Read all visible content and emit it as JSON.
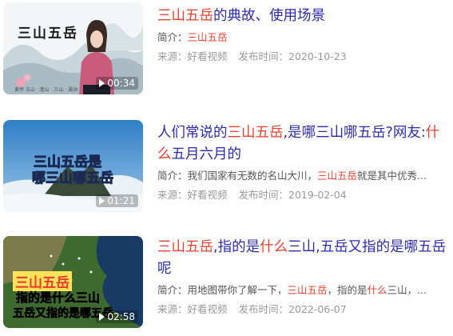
{
  "items": [
    {
      "title": [
        {
          "t": "三山五岳",
          "h": true
        },
        {
          "t": "的典故、使用场景",
          "h": false
        }
      ],
      "summary_label": "简介：",
      "summary": [
        {
          "t": "三山五岳",
          "h": true
        }
      ],
      "source": "来源：好看视频",
      "published": "发布时间：2020-10-23",
      "duration": "00:34",
      "thumb_text": "三山五岳",
      "thumb_caption": "黄帝 玉山 · 蓬山 · 方山 · 瀛洲"
    },
    {
      "title": [
        {
          "t": "人们常说的",
          "h": false
        },
        {
          "t": "三山五岳",
          "h": true
        },
        {
          "t": ",是哪三山哪五岳?网友:",
          "h": false
        },
        {
          "t": "什么",
          "h": true
        },
        {
          "t": "五月六月的",
          "h": false
        }
      ],
      "summary_label": "简介：",
      "summary": [
        {
          "t": "我们国家有无数的名山大川，",
          "h": false
        },
        {
          "t": "三山五岳",
          "h": true
        },
        {
          "t": "就是其中优秀...",
          "h": false
        }
      ],
      "source": "来源：好看视频",
      "published": "发布时间：2019-02-04",
      "duration": "01:21",
      "thumb_text_1": "三山五岳是",
      "thumb_text_2": "哪三山哪五岳"
    },
    {
      "title": [
        {
          "t": "三山五岳",
          "h": true
        },
        {
          "t": ",指的是",
          "h": false
        },
        {
          "t": "什么",
          "h": true
        },
        {
          "t": "三山,五岳又指的是哪五岳呢",
          "h": false
        }
      ],
      "summary_label": "简介：",
      "summary": [
        {
          "t": "用地图带你了解一下，",
          "h": false
        },
        {
          "t": "三山五岳",
          "h": true
        },
        {
          "t": "，指的是",
          "h": false
        },
        {
          "t": "什么",
          "h": true
        },
        {
          "t": "三山，...",
          "h": false
        }
      ],
      "source": "来源：好看视频",
      "published": "发布时间：2022-06-07",
      "duration": "02:58",
      "thumb_text_1": "三山五岳",
      "thumb_text_2": "指的是什么三山",
      "thumb_text_3": "五岳又指的是哪五岳"
    }
  ],
  "colors": {
    "title": "#2b2bb1",
    "highlight": "#e8402f",
    "meta": "#999999"
  }
}
